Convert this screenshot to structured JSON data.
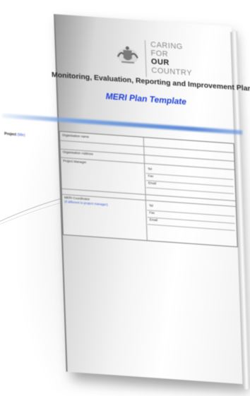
{
  "document": {
    "brand": {
      "line1": "CARING",
      "line2": "FOR",
      "line3": "OUR",
      "line4": "COUNTRY"
    },
    "title": "Monitoring, Evaluation, Reporting and Improvement Plan",
    "subtitle": "MERI Plan Template",
    "project": {
      "label": "Project",
      "value": "(title)"
    },
    "table": {
      "rows": [
        {
          "label": "Organisation name"
        },
        {
          "label": "Organisation Address"
        },
        {
          "label": "Project Manager",
          "fields": [
            "Tel",
            "Fax",
            "Email"
          ]
        },
        {
          "label": "MERI Coordinator",
          "note": "(if different to project manager)",
          "fields": [
            "Tel",
            "Fax",
            "Email"
          ]
        }
      ]
    },
    "colors": {
      "title_blue": "#1f3fd6",
      "band_blue": "#5d8ad6"
    }
  }
}
